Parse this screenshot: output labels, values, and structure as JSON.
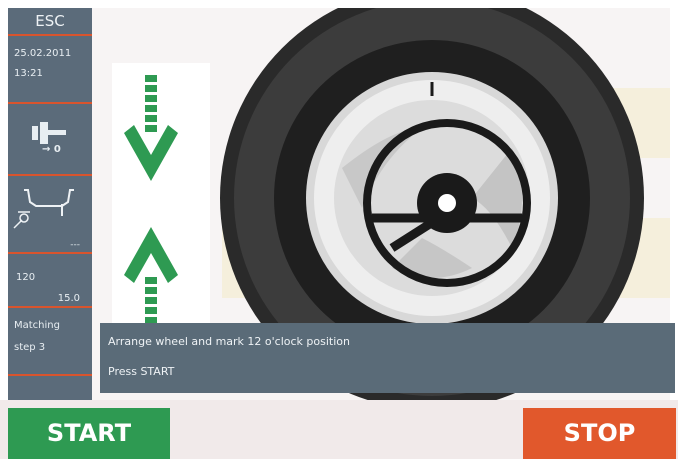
{
  "sidebar": {
    "esc_label": "ESC",
    "date": "25.02.2011",
    "time": "13:21",
    "offset_icon_value": "→ 0",
    "dots": "---",
    "value_1": "120",
    "value_2": "15.0",
    "mode_line_1": "Matching",
    "mode_line_2": "step 3"
  },
  "message": {
    "line_1": "Arrange wheel and mark 12 o'clock position",
    "line_2": "Press START"
  },
  "buttons": {
    "start_label": "START",
    "stop_label": "STOP"
  },
  "colors": {
    "sidebar": "#5b6b7a",
    "accent_line": "#d9542d",
    "start": "#2e9a52",
    "stop": "#e1582c",
    "arrow": "#2e9a52"
  }
}
